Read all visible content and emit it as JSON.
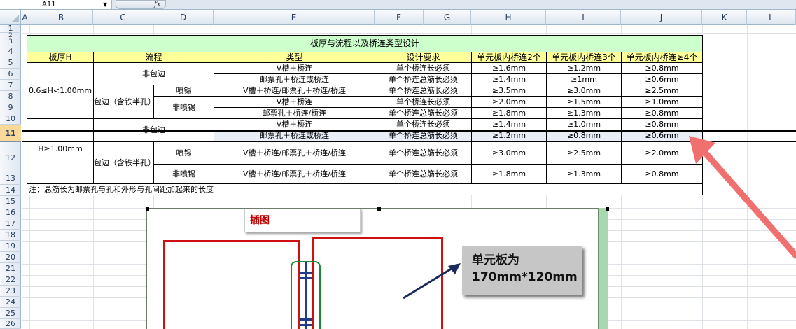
{
  "formula_bar": {
    "name_box": "A11",
    "fx_label": "fx"
  },
  "columns": [
    "A",
    "B",
    "C",
    "D",
    "E",
    "F",
    "G",
    "H",
    "I",
    "J",
    "K",
    "L"
  ],
  "rows": [
    "1",
    "2",
    "3",
    "4",
    "5",
    "6",
    "7",
    "8",
    "9",
    "10",
    "11",
    "12",
    "13",
    "14",
    "15",
    "16",
    "17",
    "18",
    "19",
    "20",
    "21",
    "22",
    "23",
    "24",
    "25",
    "26"
  ],
  "selected_row": "11",
  "table": {
    "title": "板厚与流程以及桥连类型设计",
    "headers": {
      "thickness": "板厚H",
      "flow": "流程",
      "type": "类型",
      "requirement": "设计要求",
      "bridge2": "单元板内桥连2个",
      "bridge3": "单元板内桥连3个",
      "bridge4": "单元板内桥连≥4个"
    },
    "group1_thickness": "0.6≤H<1.00mm",
    "no_edge": "非包边",
    "with_edge": "包边（含铁半孔）",
    "spray_tin": "喷锡",
    "no_spray_tin": "非喷锡",
    "no_edge_strike": "非包边",
    "group2_thickness": "H≥1.00mm",
    "rows": [
      {
        "type": "V槽＋桥连",
        "req": "单个桥连长必须",
        "b2": "≥1.6mm",
        "b3": "≥1.2mm",
        "b4": "≥0.8mm"
      },
      {
        "type": "邮票孔＋桥连或桥连",
        "req": "单个桥连总筋长必须",
        "b2": "≥1.4mm",
        "b3": "≥1mm",
        "b4": "≥0.6mm"
      },
      {
        "type": "V槽＋桥连/邮票孔＋桥连/桥连",
        "req": "单个桥连总筋长必须",
        "b2": "≥3.5mm",
        "b3": "≥3.0mm",
        "b4": "≥2.5mm"
      },
      {
        "type": "V槽＋桥连",
        "req": "单个桥连长必须",
        "b2": "≥2.0mm",
        "b3": "≥1.5mm",
        "b4": "≥1.0mm"
      },
      {
        "type": "邮票孔＋桥连/桥连",
        "req": "单个桥连总筋长必须",
        "b2": "≥1.8mm",
        "b3": "≥1.3mm",
        "b4": "≥0.8mm"
      },
      {
        "type": "V槽＋桥连",
        "req": "单个桥连长必须",
        "b2": "≥1.4mm",
        "b3": "≥1.0mm",
        "b4": "≥0.8mm"
      },
      {
        "type": "邮票孔＋桥连或桥连",
        "req": "单个桥连总筋长必须",
        "b2": "≥1.2mm",
        "b3": "≥0.8mm",
        "b4": "≥0.6mm"
      },
      {
        "type": "V槽＋桥连/邮票孔＋桥连/桥连",
        "req": "单个桥连总筋长必须",
        "b2": "≥3.0mm",
        "b3": "≥2.5mm",
        "b4": "≥2.0mm"
      },
      {
        "type": "V槽＋桥连/邮票孔＋桥连/桥连",
        "req": "单个桥连总筋长必须",
        "b2": "≥1.8mm",
        "b3": "≥1.3mm",
        "b4": "≥0.8mm"
      }
    ],
    "note": "注：总筋长为邮票孔与孔和外形与孔间距加起来的长度"
  },
  "picture": {
    "caption": "插图",
    "note_line1": "单元板为",
    "note_line2": "170mm*120mm"
  },
  "colors": {
    "title_bg": "#ccffcc",
    "header_bg": "#ffff99",
    "arrow_red": "#f07070",
    "board_red": "#d01010"
  }
}
